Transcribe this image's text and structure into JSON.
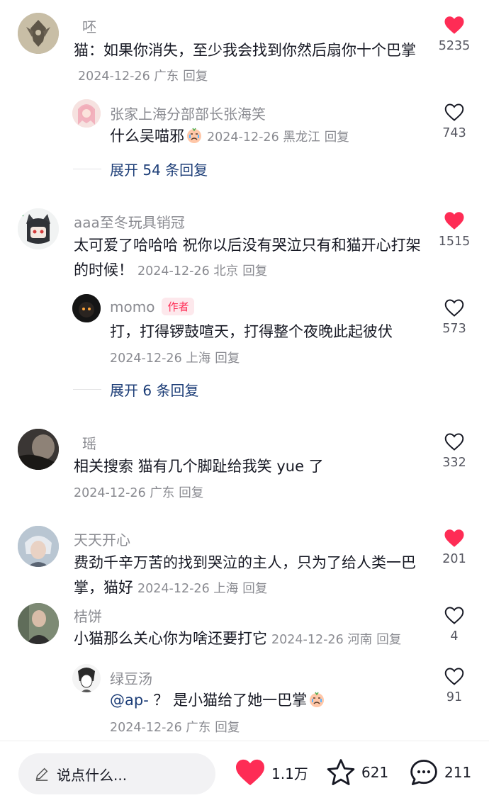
{
  "colors": {
    "like_active": "#fe2c55",
    "like_inactive": "#161823",
    "link": "#1c3d77",
    "muted": "#8a8b91"
  },
  "comments": [
    {
      "name": "呸",
      "text": "猫：如果你消失，至少我会找到你然后扇你十个巴掌",
      "date": "2024-12-26",
      "location": "广东",
      "reply": "回复",
      "likes": "5235",
      "liked": true,
      "replies": [
        {
          "name": "张家上海分部部长张海笑",
          "text": "什么吴喵邪",
          "emoji": "crying-face-icon",
          "date": "2024-12-26",
          "location": "黑龙江",
          "reply": "回复",
          "likes": "743",
          "liked": false
        }
      ],
      "expand": "展开 54 条回复"
    },
    {
      "name": "aaa至冬玩具销冠",
      "text": "太可爱了哈哈哈 祝你以后没有哭泣只有和猫开心打架的时候！",
      "date": "2024-12-26",
      "location": "北京",
      "reply": "回复",
      "likes": "1515",
      "liked": true,
      "replies": [
        {
          "name": "momo",
          "badge": "作者",
          "text": "打，打得锣鼓喧天，打得整个夜晚此起彼伏",
          "date": "2024-12-26",
          "location": "上海",
          "reply": "回复",
          "likes": "573",
          "liked": false
        }
      ],
      "expand": "展开 6 条回复"
    },
    {
      "name": "瑶",
      "text": "相关搜索 猫有几个脚趾给我笑 yue 了",
      "date": "2024-12-26",
      "location": "广东",
      "reply": "回复",
      "likes": "332",
      "liked": false
    },
    {
      "name": "天天开心",
      "text": "费劲千辛万苦的找到哭泣的主人，只为了给人类一巴掌，猫好",
      "date": "2024-12-26",
      "location": "上海",
      "reply": "回复",
      "likes": "201",
      "liked": true
    },
    {
      "name": "桔饼",
      "text": "小猫那么关心你为啥还要打它",
      "date": "2024-12-26",
      "location": "河南",
      "reply": "回复",
      "likes": "4",
      "liked": false,
      "replies": [
        {
          "name": "绿豆汤",
          "mention": "@ap-",
          "text": "？ 是小猫给了她一巴掌",
          "emoji": "crying-face-icon",
          "date": "2024-12-26",
          "location": "广东",
          "reply": "回复",
          "likes": "91",
          "liked": false
        }
      ]
    }
  ],
  "bottom_bar": {
    "placeholder": "说点什么...",
    "likes": "1.1万",
    "favorites": "621",
    "comments": "211"
  }
}
